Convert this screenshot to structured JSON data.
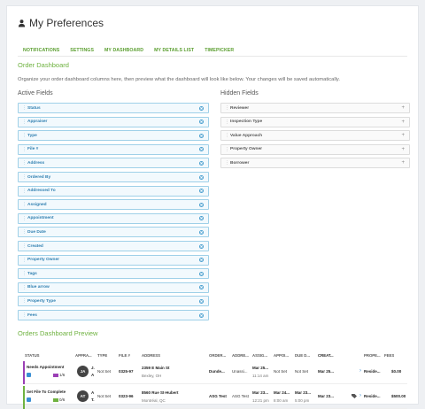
{
  "page": {
    "title": "My Preferences"
  },
  "tabs": [
    {
      "label": "NOTIFICATIONS"
    },
    {
      "label": "SETTINGS"
    },
    {
      "label": "MY DASHBOARD"
    },
    {
      "label": "MY DETAILS LIST"
    },
    {
      "label": "TIMEPICKER"
    }
  ],
  "dashboard": {
    "title": "Order Dashboard",
    "description": "Organize your order dashboard columns here, then preview what the dashboard will look like below. Your changes will be saved automatically.",
    "active_title": "Active Fields",
    "hidden_title": "Hidden Fields",
    "active_fields": [
      "Status",
      "Appraiser",
      "Type",
      "File #",
      "Address",
      "Ordered By",
      "Addressed To",
      "Assigned",
      "Appointment",
      "Due Date",
      "Created",
      "Property Owner",
      "Tags",
      "Blue arrow",
      "Property Type",
      "Fees"
    ],
    "hidden_fields": [
      "Reviewer",
      "Inspection Type",
      "Value Approach",
      "Property Owner",
      "Borrower"
    ]
  },
  "preview": {
    "title": "Orders Dashboard Preview",
    "columns": [
      "STATUS",
      "APPRA...",
      "TYPE",
      "FILE #",
      "ADDRESS",
      "ORDER...",
      "ADDRE...",
      "ASSIG...",
      "APPOI...",
      "DUE D...",
      "CREAT...",
      "PROPE...",
      "FEES"
    ],
    "rows": [
      {
        "status": "Needs Appointment",
        "count": "1/6",
        "avatar": "JA",
        "initials_a": "J.",
        "initials_b": "A",
        "type": "Not Set",
        "file": "0325-97",
        "address1": "2359 E Main St",
        "address2": "Bexley, OH",
        "ordered": "Dunde...",
        "addressed": "Unassi...",
        "assigned1": "Mar 25...",
        "assigned2": "11:14 am",
        "appt": "Not Set",
        "due": "Not Set",
        "created": "Mar 25...",
        "prop": "Reside...",
        "fees": "$0.00"
      },
      {
        "status": "Set File To Complete",
        "count": "0/6",
        "avatar": "AT",
        "initials_a": "A",
        "initials_b": "T.",
        "type": "Not Set",
        "file": "0323-96",
        "address1": "8560 Rue St-Hubert",
        "address2": "Montréal, QC",
        "ordered": "ASG Test",
        "addressed": "ASG Test",
        "assigned1": "Mar 23...",
        "assigned2": "12:21 pm",
        "appt": "Mar 24...",
        "appt2": "8:00 am",
        "due": "Mar 23...",
        "due2": "5:00 pm",
        "created": "Mar 23...",
        "prop": "Reside...",
        "fees": "$500.00"
      }
    ]
  },
  "colors": {
    "accent": "#6fb240",
    "field_border": "#9fd0e8",
    "purple": "#9b3fb5",
    "green": "#6fb240"
  }
}
